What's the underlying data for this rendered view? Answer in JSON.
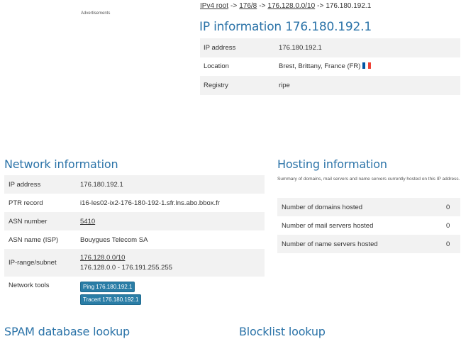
{
  "ads_label": "Advertisements",
  "breadcrumb": {
    "items": [
      {
        "label": "IPv4 root",
        "link": true
      },
      {
        "label": "176/8",
        "link": true
      },
      {
        "label": "176.128.0.0/10",
        "link": true
      },
      {
        "label": "176.180.192.1",
        "link": false
      }
    ],
    "separator": "->"
  },
  "ip_info": {
    "title": "IP information 176.180.192.1",
    "rows": [
      {
        "key": "IP address",
        "value": "176.180.192.1"
      },
      {
        "key": "Location",
        "value": "Brest, Brittany, France (FR)"
      },
      {
        "key": "Registry",
        "value": "ripe"
      }
    ]
  },
  "network_info": {
    "title": "Network information",
    "ip_address_label": "IP address",
    "ip_address": "176.180.192.1",
    "ptr_label": "PTR record",
    "ptr": "i16-les02-ix2-176-180-192-1.sfr.lns.abo.bbox.fr",
    "asn_label": "ASN number",
    "asn": "5410",
    "asn_name_label": "ASN name (ISP)",
    "asn_name": "Bouygues Telecom SA",
    "range_label": "IP-range/subnet",
    "range_subnet": "176.128.0.0/10",
    "range_span": "176.128.0.0 - 176.191.255.255",
    "tools_label": "Network tools",
    "ping_button": "Ping 176.180.192.1",
    "tracert_button": "Tracert 176.180.192.1"
  },
  "hosting_info": {
    "title": "Hosting information",
    "summary": "Summary of domains, mail servers and name servers currently hosted on this IP address.",
    "rows": [
      {
        "key": "Number of domains hosted",
        "value": "0"
      },
      {
        "key": "Number of mail servers hosted",
        "value": "0"
      },
      {
        "key": "Number of name servers hosted",
        "value": "0"
      }
    ]
  },
  "spam_title": "SPAM database lookup",
  "blocklist_title": "Blocklist lookup",
  "colors": {
    "heading": "#2b73a8",
    "button": "#2a7da6",
    "row_alt": "#f2f2f2"
  },
  "icons": {
    "flag": "france-flag-icon"
  }
}
